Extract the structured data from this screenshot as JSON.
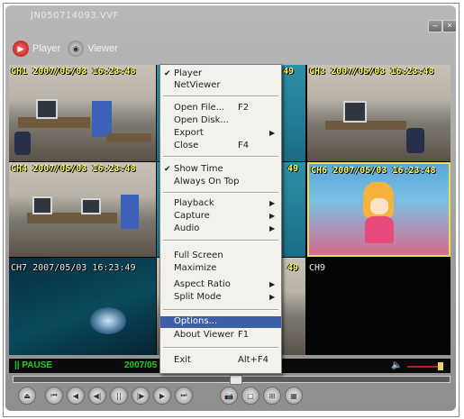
{
  "window": {
    "title": "JN050714093.VVF",
    "min_glyph": "–",
    "close_glyph": "×"
  },
  "tabs": [
    {
      "label": "Player",
      "icon": "play-icon"
    },
    {
      "label": "Viewer",
      "icon": "viewer-icon"
    }
  ],
  "channels": [
    {
      "label": "CH1 2007/05/03 16:23:48"
    },
    {
      "label": "49"
    },
    {
      "label": "CH3 2007/05/03 16:23:48"
    },
    {
      "label": "CH4 2007/05/03 16:23:48"
    },
    {
      "label": "49"
    },
    {
      "label": "CH6 2007/05/03 16:23:48"
    },
    {
      "label": "CH7 2007/05/03 16:23:49"
    },
    {
      "label": "49"
    },
    {
      "label": "CH9"
    }
  ],
  "status": {
    "pause": "|| PAUSE",
    "date": "2007/05",
    "volume_icon": "speaker-icon"
  },
  "context_menu": {
    "items": [
      {
        "label": "Player",
        "checked": true
      },
      {
        "label": "NetViewer"
      },
      {
        "label": "Open File...",
        "shortcut": "F2"
      },
      {
        "label": "Open Disk..."
      },
      {
        "label": "Export",
        "submenu": true
      },
      {
        "label": "Close",
        "shortcut": "F4"
      },
      {
        "label": "Show Time",
        "checked": true
      },
      {
        "label": "Always On Top"
      },
      {
        "label": "Playback",
        "submenu": true
      },
      {
        "label": "Capture",
        "submenu": true
      },
      {
        "label": "Audio",
        "submenu": true
      },
      {
        "label": "Full Screen"
      },
      {
        "label": "Maximize"
      },
      {
        "label": "Aspect Ratio",
        "submenu": true
      },
      {
        "label": "Split Mode",
        "submenu": true
      },
      {
        "label": "Options...",
        "highlighted": true
      },
      {
        "label": "About Viewer",
        "shortcut": "F1"
      },
      {
        "label": "Exit",
        "shortcut": "Alt+F4"
      }
    ],
    "check_glyph": "✔",
    "arrow_glyph": "▶"
  },
  "controls": [
    {
      "name": "eject",
      "glyph": "⏏"
    },
    {
      "name": "skip-back",
      "glyph": "⏮"
    },
    {
      "name": "rewind",
      "glyph": "◀"
    },
    {
      "name": "step-back",
      "glyph": "◀|"
    },
    {
      "name": "pause",
      "glyph": "||"
    },
    {
      "name": "step-forward",
      "glyph": "|▶"
    },
    {
      "name": "play",
      "glyph": "▶"
    },
    {
      "name": "skip-forward",
      "glyph": "⏭"
    },
    {
      "name": "camera",
      "glyph": "📷"
    },
    {
      "name": "split-1",
      "glyph": "▢"
    },
    {
      "name": "split-4",
      "glyph": "⊞"
    },
    {
      "name": "split-9",
      "glyph": "▦"
    }
  ]
}
